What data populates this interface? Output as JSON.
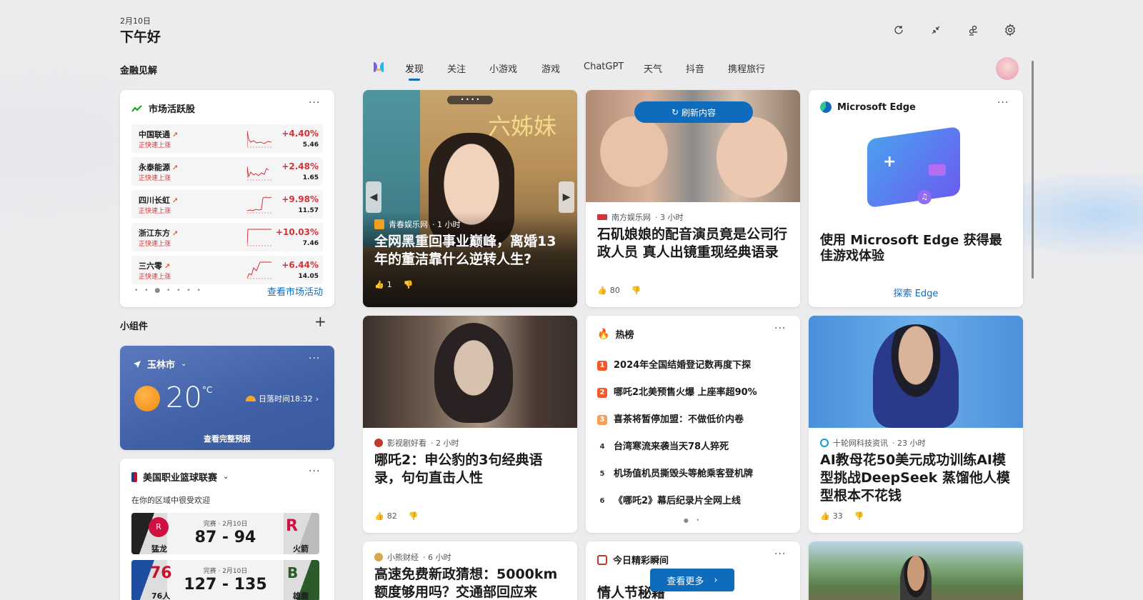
{
  "header": {
    "date": "2月10日",
    "greeting": "下午好"
  },
  "toolbar": {
    "refresh": "refresh-icon",
    "collapse": "collapse-icon",
    "accounts": "accounts-icon",
    "settings": "gear-icon"
  },
  "finance": {
    "section_title": "金融见解",
    "card_title": "市场活跃股",
    "stocks": [
      {
        "name": "中国联通",
        "status": "正快速上涨",
        "change": "+4.40%",
        "price": "5.46"
      },
      {
        "name": "永泰能源",
        "status": "正快速上涨",
        "change": "+2.48%",
        "price": "1.65"
      },
      {
        "name": "四川长虹",
        "status": "正快速上涨",
        "change": "+9.98%",
        "price": "11.57"
      },
      {
        "name": "浙江东方",
        "status": "正快速上涨",
        "change": "+10.03%",
        "price": "7.46"
      },
      {
        "name": "三六零",
        "status": "正快速上涨",
        "change": "+6.44%",
        "price": "14.05"
      }
    ],
    "link": "查看市场活动"
  },
  "widgets": {
    "section_title": "小组件"
  },
  "weather": {
    "city": "玉林市",
    "temp": "20",
    "unit": "°C",
    "sunset": "日落时间18:32",
    "link": "查看完整预报"
  },
  "nba": {
    "title": "美国职业篮球联赛",
    "subtitle": "在你的区域中很受欢迎",
    "games": [
      {
        "status": "完赛 · 2月10日",
        "score": "87 - 94",
        "home": "猛龙",
        "away": "火箭"
      },
      {
        "status": "完赛 · 2月10日",
        "score": "127 - 135",
        "home": "76人",
        "away": "雄鹿"
      }
    ]
  },
  "nav": {
    "items": [
      "发现",
      "关注",
      "小游戏",
      "游戏",
      "ChatGPT",
      "天气",
      "抖音",
      "携程旅行"
    ]
  },
  "feed": {
    "c1": {
      "source": "青春娱乐网",
      "time": " · 1 小时",
      "headline": "全网黑重回事业巅峰，离婚13年的董洁靠什么逆转人生?",
      "likes": "1",
      "overlay": "六姊妹"
    },
    "c2": {
      "source": "南方娱乐网",
      "time": " · 3 小时",
      "headline": "石矶娘娘的配音演员竟是公司行政人员 真人出镜重现经典语录",
      "likes": "80",
      "refresh": "刷新内容"
    },
    "c3": {
      "title": "Microsoft Edge",
      "headline": "使用 Microsoft Edge 获得最佳游戏体验",
      "link": "探索 Edge"
    },
    "c4": {
      "source": "影视剧好看",
      "time": " · 2 小时",
      "headline": "哪吒2：申公豹的3句经典语录，句句直击人性",
      "likes": "82"
    },
    "c5": {
      "title": "热榜",
      "items": [
        {
          "rank": "1",
          "text": "2024年全国结婚登记数再度下探"
        },
        {
          "rank": "2",
          "text": "哪吒2北美预售火爆 上座率超90%"
        },
        {
          "rank": "3",
          "text": "喜茶将暂停加盟：不做低价内卷"
        },
        {
          "rank": "4",
          "text": "台湾寒流来袭当天78人猝死"
        },
        {
          "rank": "5",
          "text": "机场值机员撕毁头等舱乘客登机牌"
        },
        {
          "rank": "6",
          "text": "《哪吒2》幕后纪录片全网上线"
        }
      ]
    },
    "c6": {
      "source": "十轮网科技资讯",
      "time": " · 23 小时",
      "headline": "AI教母花50美元成功训练AI模型挑战DeepSeek 蒸馏他人模型根本不花钱",
      "likes": "33"
    },
    "c7": {
      "source": "小熊财经",
      "time": " · 6 小时",
      "headline": "高速免费新政猜想：5000km额度够用吗？交通部回应来"
    },
    "c8": {
      "title": "今日精彩瞬间",
      "headline": "情人节秘籍",
      "button": "查看更多"
    }
  }
}
